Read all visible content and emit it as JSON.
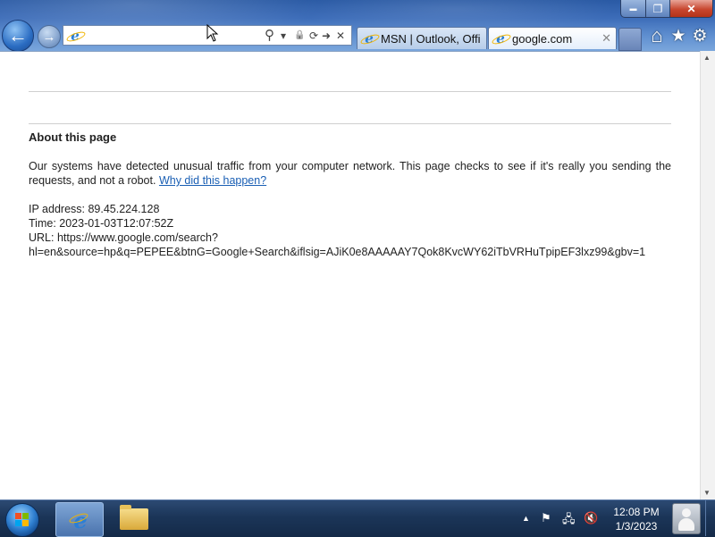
{
  "window": {
    "minimize_glyph": "▬",
    "maximize_glyph": "❐",
    "close_glyph": "✕"
  },
  "navigation": {
    "back_glyph": "←",
    "forward_glyph": "→"
  },
  "address_bar": {
    "value": "",
    "search_glyph": "⚲",
    "dropdown_glyph": "▾",
    "lock_glyph": "🔒",
    "refresh_glyph": "⟳",
    "go_glyph": "➜",
    "stop_glyph": "✕"
  },
  "tabs": [
    {
      "title": "MSN | Outlook, Offi",
      "active": false
    },
    {
      "title": "google.com",
      "active": true,
      "close_glyph": "✕"
    }
  ],
  "toolbar": {
    "home_glyph": "⌂",
    "favorites_glyph": "★",
    "tools_glyph": "⚙"
  },
  "page": {
    "heading": "About this page",
    "message": "Our systems have detected unusual traffic from your computer network. This page checks to see if it's really you sending the requests, and not a robot.",
    "link_text": "Why did this happen?",
    "ip_line": "IP address: 89.45.224.128",
    "time_line": "Time: 2023-01-03T12:07:52Z",
    "url_line1": "URL: https://www.google.com/search?",
    "url_line2": "hl=en&source=hp&q=PEPEE&btnG=Google+Search&iflsig=AJiK0e8AAAAAY7Qok8KvcWY62iTbVRHuTpipEF3lxz99&gbv=1"
  },
  "taskbar": {
    "tray_show_hidden_glyph": "▲",
    "tray_flag_glyph": "⚑",
    "tray_network_glyph": "🖧",
    "tray_volume_glyph": "🔇",
    "clock_time": "12:08 PM",
    "clock_date": "1/3/2023"
  },
  "colors": {
    "link": "#1a5fb4",
    "title_bar": "#2a5aa4",
    "taskbar": "#1b3558"
  }
}
